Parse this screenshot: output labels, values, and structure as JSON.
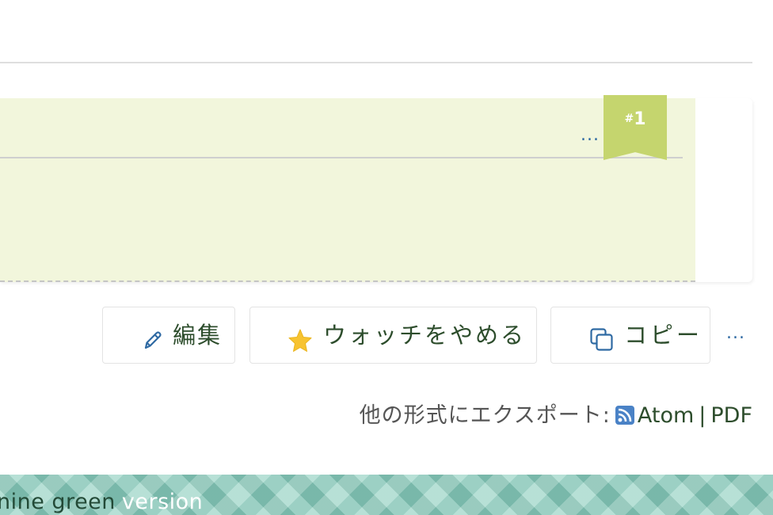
{
  "journal": {
    "more_label": "...",
    "note_number": "1",
    "note_hash": "#"
  },
  "actions": {
    "edit_label": "編集",
    "watch_label": "ウォッチをやめる",
    "copy_label": "コピー",
    "more_label": "..."
  },
  "export": {
    "label": "他の形式にエクスポート:",
    "formats": [
      "Atom",
      "PDF"
    ],
    "separator": "|"
  },
  "footer": {
    "text_dark": "nine green",
    "text_light": "version"
  },
  "colors": {
    "journal_bg": "#f2f6dc",
    "ribbon": "#c5d56e",
    "link_blue": "#2f6aa3",
    "text_green": "#2d4d2c",
    "footer": "#8fcfc0",
    "star": "#f7c331"
  },
  "icons": {
    "edit": "pencil-icon",
    "watch": "star-icon",
    "copy": "copy-icon",
    "feed": "rss-feed-icon"
  }
}
